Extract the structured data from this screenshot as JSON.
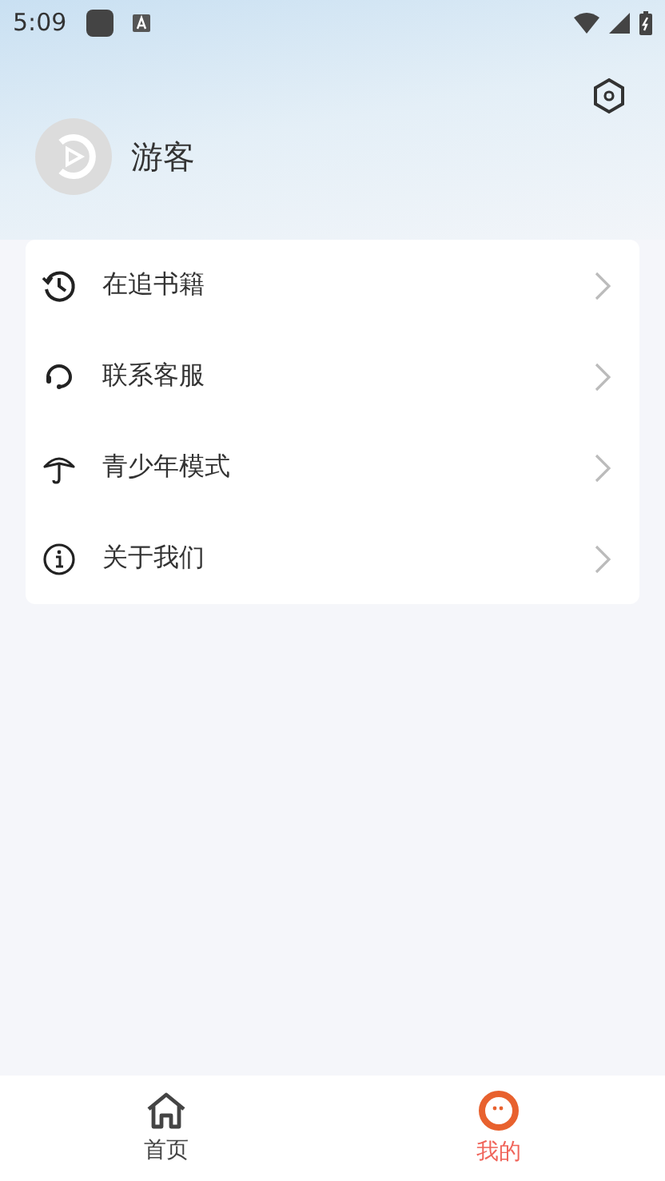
{
  "status_bar": {
    "time": "5:09"
  },
  "profile": {
    "name": "游客"
  },
  "menu": [
    {
      "kind": "history",
      "label": "在追书籍"
    },
    {
      "kind": "support",
      "label": "联系客服"
    },
    {
      "kind": "umbrella",
      "label": "青少年模式"
    },
    {
      "kind": "info",
      "label": "关于我们"
    }
  ],
  "tabs": [
    {
      "kind": "home",
      "label": "首页",
      "selected": false
    },
    {
      "kind": "me",
      "label": "我的",
      "selected": true
    }
  ]
}
